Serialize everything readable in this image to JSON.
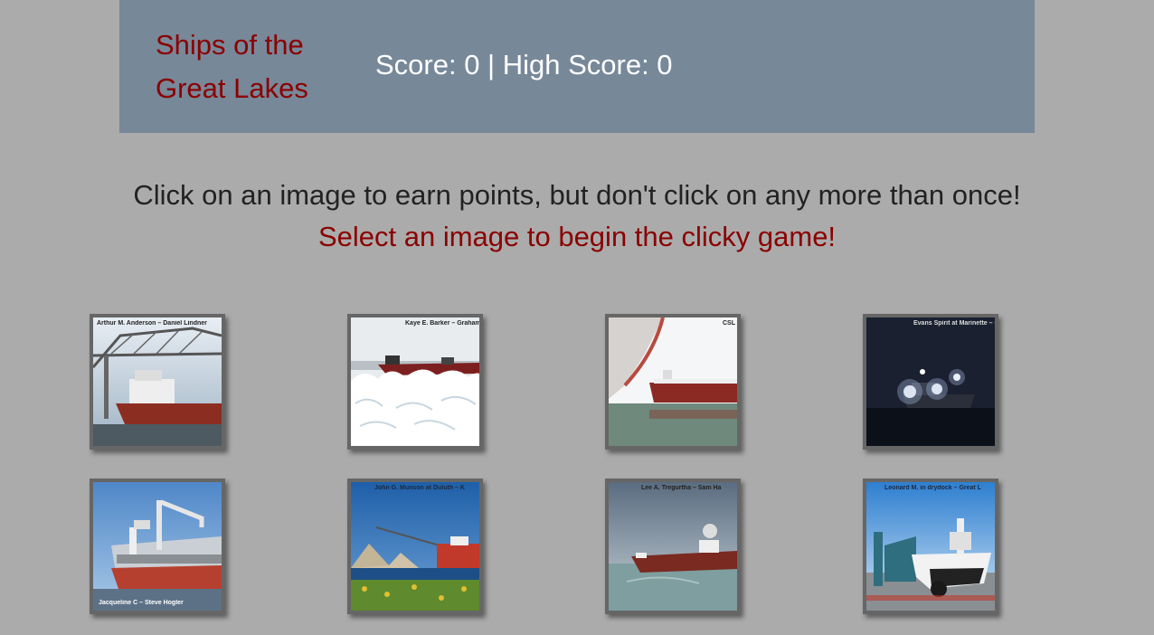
{
  "header": {
    "brand": "Ships of the Great Lakes",
    "score_text": "Score: 0 | High Score: 0"
  },
  "instructions": {
    "main": "Click on an image to earn points, but don't click on any more than once!",
    "status": "Select an image to begin the clicky game!"
  },
  "colors": {
    "page_background": "#ababab",
    "navbar": "#778899",
    "accent_red": "#8b0000",
    "tile_border": "#666666"
  },
  "images": [
    {
      "id": "arthur-anderson",
      "caption": "Arthur M. Anderson – Daniel Lindner"
    },
    {
      "id": "kaye-barker",
      "caption": "Kaye E. Barker – Graham Grattan"
    },
    {
      "id": "csl-ship",
      "caption": "CSL W"
    },
    {
      "id": "evans-spirit",
      "caption": "Evans Spirit at Marinette – Chuck Zier"
    },
    {
      "id": "jacqueline-c",
      "caption": "Jacqueline C – Steve Hogler"
    },
    {
      "id": "john-munson",
      "caption": "John G. Munson at Duluth – K"
    },
    {
      "id": "lee-tregurtha",
      "caption": "Lee A. Tregurtha – Sam Ha"
    },
    {
      "id": "leonard-m",
      "caption": "Leonard M. in drydock – Great L"
    }
  ]
}
